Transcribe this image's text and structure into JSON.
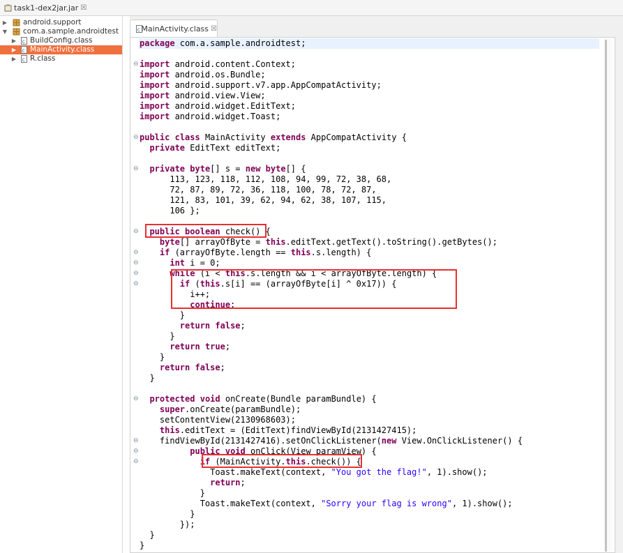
{
  "outer_tab": {
    "title": "task1-dex2jar.jar",
    "close": "☒"
  },
  "tree": {
    "items": [
      {
        "label": "android.support",
        "expanded": false,
        "icon": "package-icon"
      },
      {
        "label": "com.a.sample.androidtest",
        "expanded": true,
        "icon": "package-icon"
      },
      {
        "label": "BuildConfig.class",
        "expanded": false,
        "icon": "class-file-icon"
      },
      {
        "label": "MainActivity.class",
        "expanded": false,
        "icon": "class-file-icon",
        "selected": true
      },
      {
        "label": "R.class",
        "expanded": false,
        "icon": "class-file-icon"
      }
    ]
  },
  "editor": {
    "tab_title": "MainActivity.class",
    "tab_close": "☒",
    "code_lines": [
      "package com.a.sample.androidtest;",
      "",
      "import android.content.Context;",
      "import android.os.Bundle;",
      "import android.support.v7.app.AppCompatActivity;",
      "import android.view.View;",
      "import android.widget.EditText;",
      "import android.widget.Toast;",
      "",
      "public class MainActivity extends AppCompatActivity {",
      "  private EditText editText;",
      "",
      "  private byte[] s = new byte[] {",
      "      113, 123, 118, 112, 108, 94, 99, 72, 38, 68,",
      "      72, 87, 89, 72, 36, 118, 100, 78, 72, 87,",
      "      121, 83, 101, 39, 62, 94, 62, 38, 107, 115,",
      "      106 };",
      "",
      "  public boolean check() {",
      "    byte[] arrayOfByte = this.editText.getText().toString().getBytes();",
      "    if (arrayOfByte.length == this.s.length) {",
      "      int i = 0;",
      "      while (i < this.s.length && i < arrayOfByte.length) {",
      "        if (this.s[i] == (arrayOfByte[i] ^ 0x17)) {",
      "          i++;",
      "          continue;",
      "        }",
      "        return false;",
      "      }",
      "      return true;",
      "    }",
      "    return false;",
      "  }",
      "",
      "  protected void onCreate(Bundle paramBundle) {",
      "    super.onCreate(paramBundle);",
      "    setContentView(2130968603);",
      "    this.editText = (EditText)findViewById(2131427415);",
      "    findViewById(2131427416).setOnClickListener(new View.OnClickListener() {",
      "          public void onClick(View paramView) {",
      "            if (MainActivity.this.check()) {",
      "              Toast.makeText(context, \"You got the flag!\", 1).show();",
      "              return;",
      "            }",
      "            Toast.makeText(context, \"Sorry your flag is wrong\", 1).show();",
      "          }",
      "        });",
      "  }",
      "}"
    ]
  },
  "highlights": [
    "check-method-signature",
    "xor-comparison-block",
    "check-call-in-onclick"
  ],
  "colors": {
    "keyword": "#7f0055",
    "string": "#2a00ff",
    "field": "#0000c0",
    "selection": "#f0703f",
    "highlight_box": "#e53030"
  }
}
